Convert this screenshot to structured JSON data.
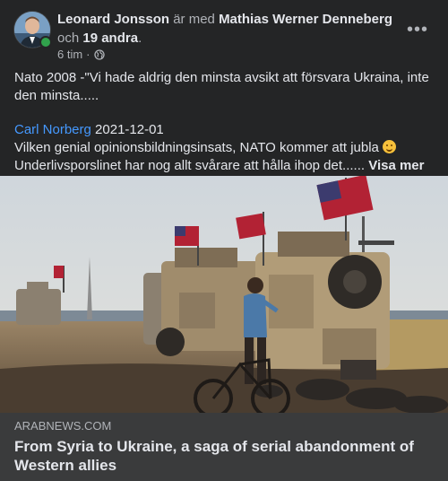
{
  "author": {
    "name": "Leonard Jonsson",
    "with_text": "är med",
    "tagged": "Mathias Werner Denneberg",
    "and_text": "och",
    "others": "19 andra",
    "end": "."
  },
  "meta": {
    "time": "6 tim",
    "separator": "·",
    "privacy_icon": "globe-icon"
  },
  "menu": {
    "more_label": "•••"
  },
  "post": {
    "line1": "Nato 2008 -\"Vi hade aldrig den minsta avsikt att försvara Ukraina, inte den minsta.....",
    "quote_author": "Carl Norberg",
    "quote_date": "2021-12-01",
    "line2": "Vilken genial opinionsbildningsinsats, NATO kommer att jubla",
    "line3": "Underlivsporslinet har nog allt svårare att hålla ihop det......",
    "see_more": "Visa mer"
  },
  "link_preview": {
    "domain": "ARABNEWS.COM",
    "headline": "From Syria to Ukraine, a saga of serial abandonment of Western allies"
  },
  "colors": {
    "background": "#242526",
    "link": "#4599ff",
    "preview_bg": "#3a3b3c",
    "online": "#31a24c"
  }
}
